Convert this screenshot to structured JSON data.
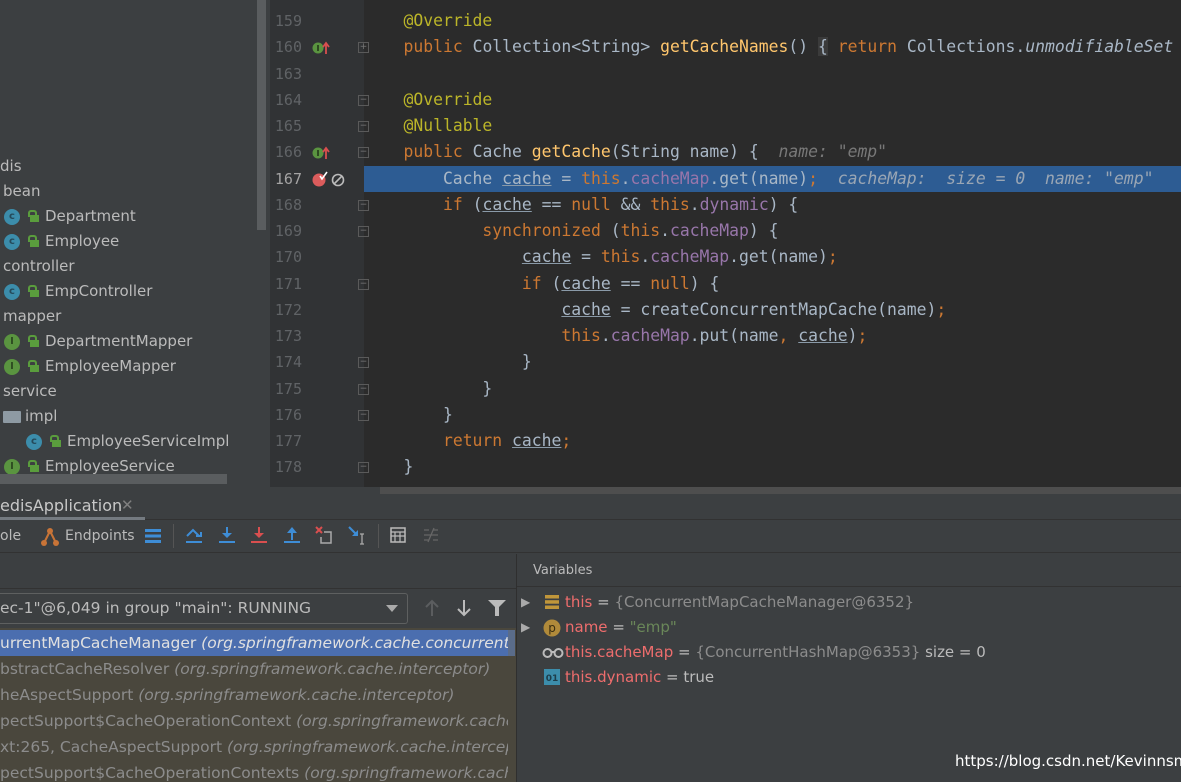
{
  "project_tree": [
    {
      "label": "dis",
      "icon": "none",
      "indent": 0
    },
    {
      "label": "bean",
      "icon": "none",
      "indent": 1
    },
    {
      "label": "Department",
      "icon": "class-icon",
      "indent": 2
    },
    {
      "label": "Employee",
      "icon": "class-icon",
      "indent": 2
    },
    {
      "label": "controller",
      "icon": "none",
      "indent": 1
    },
    {
      "label": "EmpController",
      "icon": "class-icon",
      "indent": 2
    },
    {
      "label": "mapper",
      "icon": "none",
      "indent": 1
    },
    {
      "label": "DepartmentMapper",
      "icon": "interface-icon",
      "indent": 2
    },
    {
      "label": "EmployeeMapper",
      "icon": "interface-icon",
      "indent": 2
    },
    {
      "label": "service",
      "icon": "none",
      "indent": 1
    },
    {
      "label": "impl",
      "icon": "folder-icon",
      "indent": 1
    },
    {
      "label": "EmployeeServiceImpl",
      "icon": "class-icon",
      "indent": 3
    },
    {
      "label": "EmployeeService",
      "icon": "interface-icon",
      "indent": 2
    }
  ],
  "editor": {
    "lines": [
      {
        "num": "159",
        "tokens": [
          [
            "    ",
            ""
          ],
          [
            "@Override",
            "ann"
          ]
        ]
      },
      {
        "num": "160",
        "marker": "implements",
        "fold": "+",
        "tokens": [
          [
            "    ",
            ""
          ],
          [
            "public",
            "kw"
          ],
          [
            " Collection<String> ",
            ""
          ],
          [
            "getCacheNames",
            "fn"
          ],
          [
            "() ",
            ""
          ],
          [
            "{",
            "fold-box"
          ],
          [
            " ",
            ""
          ],
          [
            "return",
            "kw"
          ],
          [
            " Collections.",
            ""
          ],
          [
            "unmodifiableSet",
            "it"
          ]
        ]
      },
      {
        "num": "163",
        "tokens": []
      },
      {
        "num": "164",
        "fold": "-",
        "tokens": [
          [
            "    ",
            ""
          ],
          [
            "@Override",
            "ann"
          ]
        ]
      },
      {
        "num": "165",
        "fold": "-",
        "tokens": [
          [
            "    ",
            ""
          ],
          [
            "@Nullable",
            "ann"
          ]
        ]
      },
      {
        "num": "166",
        "marker": "implements",
        "fold": "-",
        "tokens": [
          [
            "    ",
            ""
          ],
          [
            "public",
            "kw"
          ],
          [
            " Cache ",
            ""
          ],
          [
            "getCache",
            "fn"
          ],
          [
            "(String name) {  ",
            ""
          ],
          [
            "name: \"emp\"",
            "hint"
          ]
        ]
      },
      {
        "num": "167",
        "current": true,
        "breakpoint": true,
        "tokens": [
          [
            "        Cache ",
            ""
          ],
          [
            "cache",
            "ul"
          ],
          [
            " = ",
            ""
          ],
          [
            "this",
            "kw"
          ],
          [
            ".",
            ""
          ],
          [
            "cacheMap",
            "fld"
          ],
          [
            ".get(name)",
            ""
          ],
          [
            ";",
            "kw"
          ],
          [
            "  ",
            ""
          ],
          [
            "cacheMap:  size = 0  name: \"emp\"",
            "hint"
          ]
        ]
      },
      {
        "num": "168",
        "fold": "-",
        "tokens": [
          [
            "        ",
            ""
          ],
          [
            "if",
            "kw"
          ],
          [
            " (",
            ""
          ],
          [
            "cache",
            "ul"
          ],
          [
            " == ",
            ""
          ],
          [
            "null",
            "kw"
          ],
          [
            " && ",
            ""
          ],
          [
            "this",
            "kw"
          ],
          [
            ".",
            ""
          ],
          [
            "dynamic",
            "fld"
          ],
          [
            ") {",
            ""
          ]
        ]
      },
      {
        "num": "169",
        "fold": "-",
        "tokens": [
          [
            "            ",
            ""
          ],
          [
            "synchronized",
            "kw"
          ],
          [
            " (",
            ""
          ],
          [
            "this",
            "kw"
          ],
          [
            ".",
            ""
          ],
          [
            "cacheMap",
            "fld"
          ],
          [
            ") {",
            ""
          ]
        ]
      },
      {
        "num": "170",
        "tokens": [
          [
            "                ",
            ""
          ],
          [
            "cache",
            "ul"
          ],
          [
            " = ",
            ""
          ],
          [
            "this",
            "kw"
          ],
          [
            ".",
            ""
          ],
          [
            "cacheMap",
            "fld"
          ],
          [
            ".get(name)",
            ""
          ],
          [
            ";",
            "kw"
          ]
        ]
      },
      {
        "num": "171",
        "fold": "-",
        "tokens": [
          [
            "                ",
            ""
          ],
          [
            "if",
            "kw"
          ],
          [
            " (",
            ""
          ],
          [
            "cache",
            "ul"
          ],
          [
            " == ",
            ""
          ],
          [
            "null",
            "kw"
          ],
          [
            ") {",
            ""
          ]
        ]
      },
      {
        "num": "172",
        "tokens": [
          [
            "                    ",
            ""
          ],
          [
            "cache",
            "ul"
          ],
          [
            " = createConcurrentMapCache(name)",
            ""
          ],
          [
            ";",
            "kw"
          ]
        ]
      },
      {
        "num": "173",
        "tokens": [
          [
            "                    ",
            ""
          ],
          [
            "this",
            "kw"
          ],
          [
            ".",
            ""
          ],
          [
            "cacheMap",
            "fld"
          ],
          [
            ".put(name",
            ""
          ],
          [
            ",",
            "kw"
          ],
          [
            " ",
            ""
          ],
          [
            "cache",
            "ul"
          ],
          [
            ")",
            ""
          ],
          [
            ";",
            "kw"
          ]
        ]
      },
      {
        "num": "174",
        "fold": "-",
        "tokens": [
          [
            "                }",
            ""
          ]
        ]
      },
      {
        "num": "175",
        "fold": "-",
        "tokens": [
          [
            "            }",
            ""
          ]
        ]
      },
      {
        "num": "176",
        "fold": "-",
        "tokens": [
          [
            "        }",
            ""
          ]
        ]
      },
      {
        "num": "177",
        "tokens": [
          [
            "        ",
            ""
          ],
          [
            "return",
            "kw"
          ],
          [
            " ",
            ""
          ],
          [
            "cache",
            "ul"
          ],
          [
            ";",
            "kw"
          ]
        ]
      },
      {
        "num": "178",
        "fold": "-",
        "tokens": [
          [
            "    }",
            ""
          ]
        ]
      }
    ]
  },
  "debug": {
    "tab_label": "edisApplication",
    "toolbar": {
      "console_label": "ole",
      "endpoints_label": "Endpoints"
    },
    "thread_select": "ec-1\"@6,049 in group \"main\": RUNNING",
    "frames": [
      {
        "method": "urrentMapCacheManager",
        "pkg": "(org.springframework.cache.concurrent)",
        "selected": true
      },
      {
        "method": "bstractCacheResolver",
        "pkg": "(org.springframework.cache.interceptor)"
      },
      {
        "method": "heAspectSupport",
        "pkg": "(org.springframework.cache.interceptor)"
      },
      {
        "method": "pectSupport$CacheOperationContext",
        "pkg": "(org.springframework.cache.inte"
      },
      {
        "method": "xt:265, CacheAspectSupport",
        "pkg": "(org.springframework.cache.interceptor)"
      },
      {
        "method": "pectSupport$CacheOperationContexts",
        "pkg": "(org.springframework.cache.int"
      }
    ],
    "variables_title": "Variables",
    "variables": [
      {
        "name": "this",
        "eq": " = ",
        "value": "{ConcurrentMapCacheManager@6352}",
        "extra": "",
        "icon": "field-list-icon",
        "expandable": true,
        "vtype": "obj"
      },
      {
        "name": "name",
        "eq": " = ",
        "value": "\"emp\"",
        "extra": "",
        "icon": "parameter-icon",
        "expandable": true,
        "vtype": "str"
      },
      {
        "name": "this.cacheMap",
        "eq": " = ",
        "value": "{ConcurrentHashMap@6353}",
        "extra": "  size = 0",
        "icon": "watch-icon",
        "expandable": false,
        "vtype": "obj"
      },
      {
        "name": "this.dynamic",
        "eq": " = ",
        "value": "true",
        "extra": "",
        "icon": "primitive-icon",
        "expandable": false,
        "vtype": "plain"
      }
    ]
  },
  "watermark": "https://blog.csdn.net/Kevinnsm",
  "colors": {
    "keyword": "#cc7832",
    "annotation": "#bbb529",
    "method": "#ffc66d",
    "field": "#9876aa",
    "current_line": "#2d5c93",
    "selected_frame": "#4b6eaf"
  }
}
